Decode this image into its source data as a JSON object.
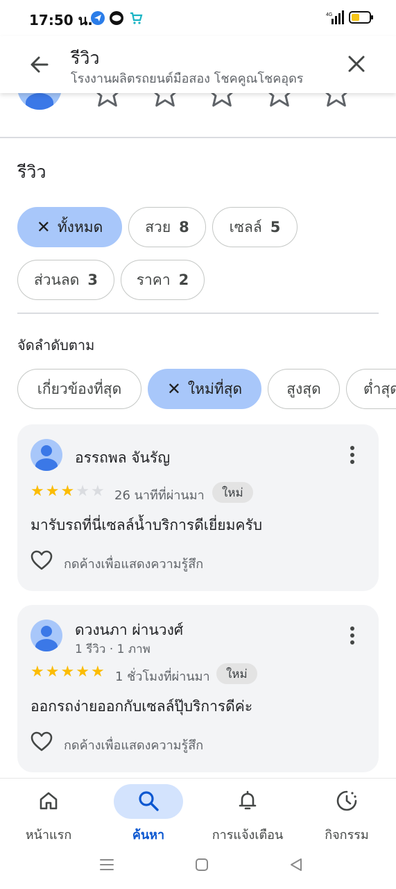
{
  "status_bar": {
    "time": "17:50 น.",
    "network": "4G",
    "notification_icons": [
      "telegram-icon",
      "line-icon",
      "shop-icon"
    ]
  },
  "app_bar": {
    "title": "รีวิว",
    "subtitle": "โรงงานผลิตรถยนต์มือสอง โชคคูณโชคอุดร"
  },
  "section": {
    "title": "รีวิว"
  },
  "filter_chips": [
    {
      "label": "ทั้งหมด",
      "count": "",
      "selected": true
    },
    {
      "label": "สวย",
      "count": "8",
      "selected": false
    },
    {
      "label": "เซลล์",
      "count": "5",
      "selected": false
    },
    {
      "label": "ส่วนลด",
      "count": "3",
      "selected": false
    },
    {
      "label": "ราคา",
      "count": "2",
      "selected": false
    }
  ],
  "sort": {
    "label": "จัดลำดับตาม",
    "options": [
      {
        "label": "เกี่ยวข้องที่สุด",
        "selected": false
      },
      {
        "label": "ใหม่ที่สุด",
        "selected": true
      },
      {
        "label": "สูงสุด",
        "selected": false
      },
      {
        "label": "ต่ำสุด",
        "selected": false
      }
    ]
  },
  "reviews": [
    {
      "name": "อรรถพล จันรัญ",
      "meta": "",
      "rating": 3,
      "max_rating": 5,
      "time": "26 นาทีที่ผ่านมา",
      "badge": "ใหม่",
      "text": "มารับรถที่นี่เซลล์น้ำบริการดีเยี่ยมครับ",
      "like_hint": "กดค้างเพื่อแสดงความรู้สึก"
    },
    {
      "name": "ดวงนภา ผ่านวงศ์",
      "meta": "1 รีวิว · 1 ภาพ",
      "rating": 5,
      "max_rating": 5,
      "time": "1 ชั่วโมงที่ผ่านมา",
      "badge": "ใหม่",
      "text": "ออกรถง่ายออกกับเซลล์ปุ๊บริการดีค่ะ",
      "like_hint": "กดค้างเพื่อแสดงความรู้สึก"
    }
  ],
  "bottom_nav": [
    {
      "label": "หน้าแรก",
      "icon": "home-icon",
      "active": false
    },
    {
      "label": "ค้นหา",
      "icon": "search-icon",
      "active": true
    },
    {
      "label": "การแจ้งเตือน",
      "icon": "bell-icon",
      "active": false
    },
    {
      "label": "กิจกรรม",
      "icon": "activity-icon",
      "active": false
    }
  ],
  "colors": {
    "selected_chip": "#a8c7fa",
    "star_on": "#fbbc04",
    "star_off": "#dadce0",
    "active_nav": "#0b57d0",
    "card_bg": "#f3f4f6"
  }
}
